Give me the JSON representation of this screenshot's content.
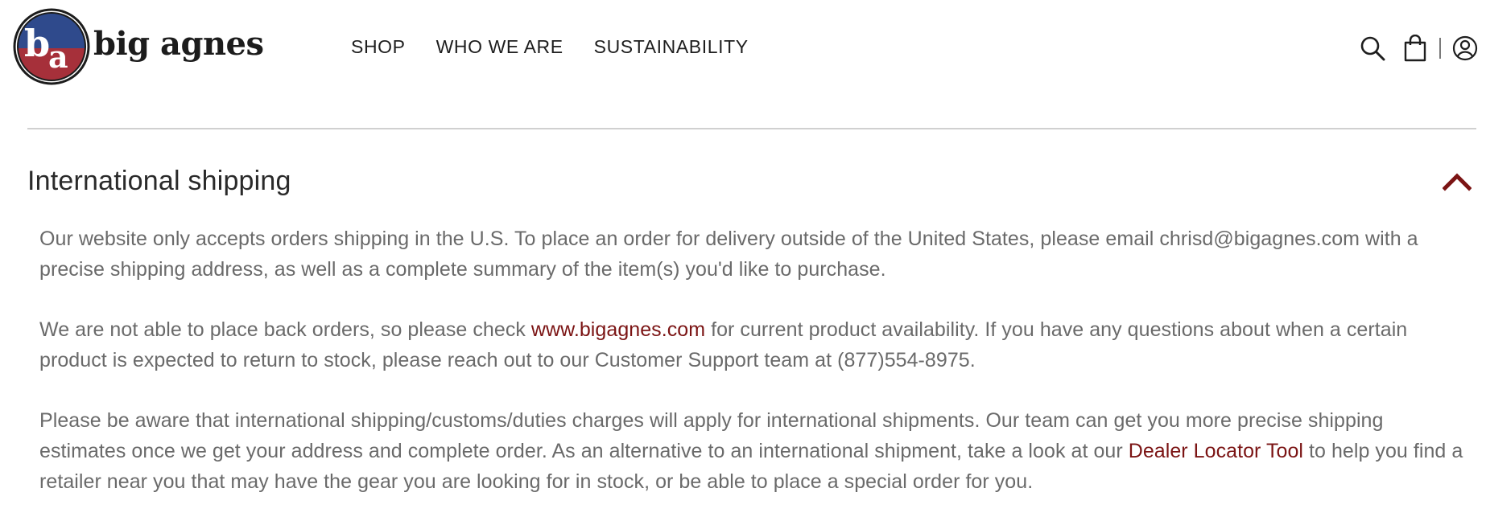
{
  "brand": {
    "logo_alt": "big agnes",
    "badge_letters": "ba",
    "wordmark": "big agnes",
    "colors": {
      "badge_blue": "#2f4a8c",
      "badge_red": "#a6303a",
      "badge_ring": "#1c1c1c"
    }
  },
  "nav": {
    "items": [
      {
        "label": "SHOP"
      },
      {
        "label": "WHO WE ARE"
      },
      {
        "label": "SUSTAINABILITY"
      }
    ]
  },
  "utility": {
    "icons": [
      "search-icon",
      "cart-icon",
      "account-icon"
    ]
  },
  "section": {
    "title": "International shipping",
    "expanded": true,
    "toggle_icon": "chevron-up-icon",
    "accent_color": "#7b1414",
    "paragraphs": {
      "p1": {
        "text": "Our website only accepts orders shipping in the U.S. To place an order for delivery outside of the United States, please email chrisd@bigagnes.com with a precise shipping address, as well as a complete summary of the item(s) you'd like to purchase."
      },
      "p2": {
        "before": "We are not able to place back orders, so please check ",
        "link": "www.bigagnes.com",
        "after": " for current product availability. If you have any questions about when a certain product is expected to return to stock, please reach out to our Customer Support team at (877)554-8975."
      },
      "p3": {
        "before": "Please be aware that international shipping/customs/duties charges will apply for international shipments. Our team can get you more precise shipping estimates once we get your address and complete order. As an alternative to an international shipment, take a look at our ",
        "link": "Dealer Locator Tool",
        "after": " to help you find a retailer near you that may have the gear you are looking for in stock, or be able to place a special order for you."
      }
    }
  }
}
